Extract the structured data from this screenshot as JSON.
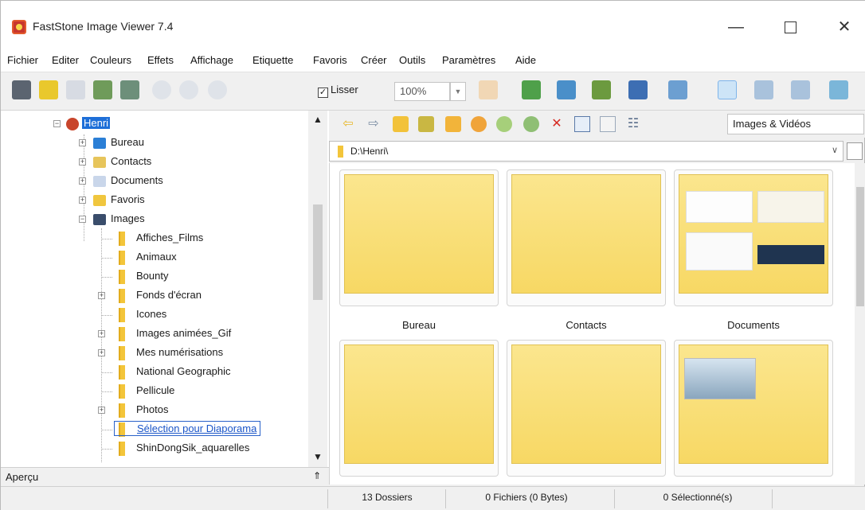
{
  "window": {
    "title": "FastStone Image Viewer 7.4",
    "minimize": "—",
    "maximize": "",
    "close": "✕"
  },
  "menu": [
    "Fichier",
    "Editer",
    "Couleurs",
    "Effets",
    "Affichage",
    "Etiquette",
    "Favoris",
    "Créer",
    "Outils",
    "Paramètres",
    "Aide"
  ],
  "toolbar": {
    "smooth_label": "Lisser",
    "smooth_checked": "✓",
    "zoom_value": "100%"
  },
  "tree": {
    "root": "Henri",
    "items": [
      "Bureau",
      "Contacts",
      "Documents",
      "Favoris",
      "Images"
    ],
    "images_children": [
      "Affiches_Films",
      "Animaux",
      "Bounty",
      "Fonds d'écran",
      "Icones",
      "Images animées_Gif",
      "Mes numérisations",
      "National Geographic",
      "Pellicule",
      "Photos",
      "Sélection pour Diaporama",
      "ShinDongSik_aquarelles"
    ],
    "preview_label": "Aperçu"
  },
  "browser": {
    "filter": "Images & Vidéos",
    "path": "D:\\Henri\\",
    "thumbnails": [
      "Bureau",
      "Contacts",
      "Documents",
      "",
      "",
      ""
    ]
  },
  "status": {
    "folders": "13 Dossiers",
    "files": "0 Fichiers (0 Bytes)",
    "selected": "0 Sélectionné(s)"
  }
}
